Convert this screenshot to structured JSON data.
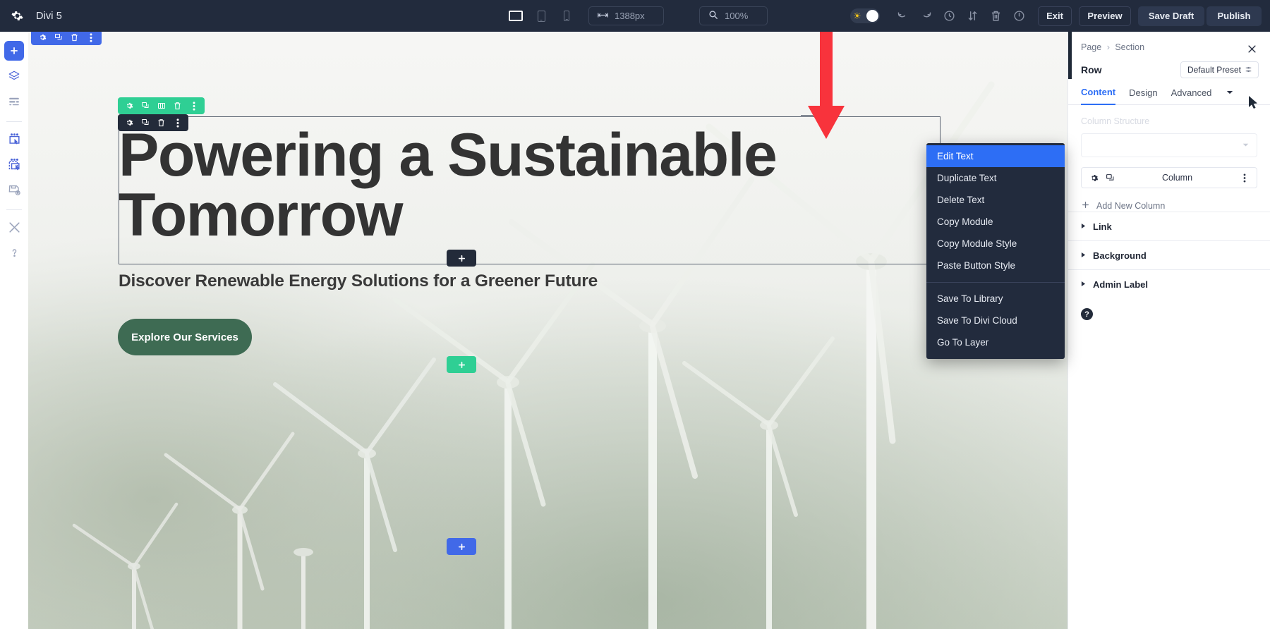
{
  "app": {
    "gear_icon": "gear-icon",
    "title": "Divi 5"
  },
  "topbar": {
    "devices": [
      {
        "name": "desktop-view-button",
        "icon": "desktop-icon",
        "active": true
      },
      {
        "name": "tablet-view-button",
        "icon": "tablet-icon",
        "active": false
      },
      {
        "name": "phone-view-button",
        "icon": "phone-icon",
        "active": false
      }
    ],
    "width_field": {
      "icon": "arrows-horizontal-icon",
      "value": "1388px"
    },
    "zoom_field": {
      "icon": "magnifier-icon",
      "value": "100%"
    },
    "theme_toggle": {
      "icon": "sun-icon",
      "state": "light"
    },
    "icons": [
      {
        "name": "undo-button",
        "icon": "undo-icon"
      },
      {
        "name": "redo-button",
        "icon": "redo-icon"
      },
      {
        "name": "history-button",
        "icon": "clock-icon"
      },
      {
        "name": "responsive-sort-button",
        "icon": "arrows-updown-icon"
      },
      {
        "name": "trash-button",
        "icon": "trash-icon"
      },
      {
        "name": "power-button",
        "icon": "power-icon"
      }
    ],
    "exit_label": "Exit",
    "preview_label": "Preview",
    "save_draft_label": "Save Draft",
    "publish_label": "Publish"
  },
  "rail": {
    "items": [
      {
        "name": "add-element-button",
        "icon": "plus-icon",
        "active": true
      },
      {
        "name": "layers-button",
        "icon": "layers-icon",
        "active": false
      },
      {
        "name": "wireframe-button",
        "icon": "wireframe-icon",
        "active": false
      },
      {
        "name": "select-module-button",
        "icon": "select-module-icon",
        "active": false
      },
      {
        "name": "multiselect-button",
        "icon": "multiselect-icon",
        "active": false
      },
      {
        "name": "save-layout-button",
        "icon": "save-layout-icon",
        "active": false
      },
      {
        "name": "tools-button",
        "icon": "wrench-icon",
        "active": false
      },
      {
        "name": "help-button",
        "icon": "question-mark-icon",
        "active": false
      }
    ]
  },
  "canvas": {
    "corner_toolbar": [
      "gear-icon",
      "duplicate-icon",
      "trash-icon",
      "dots-vertical-icon"
    ],
    "row_toolbar": [
      "gear-icon",
      "duplicate-icon",
      "columns-icon",
      "trash-icon",
      "dots-vertical-icon"
    ],
    "module_toolbar": [
      "gear-icon",
      "duplicate-icon",
      "trash-icon",
      "dots-vertical-icon"
    ],
    "headline": "Powering a Sustainable Tomorrow",
    "subheadline": "Discover Renewable Energy Solutions for a Greener Future",
    "cta_label": "Explore Our Services",
    "add_chips": [
      {
        "name": "add-module-chip-dark",
        "label": "+"
      },
      {
        "name": "add-row-chip-green",
        "label": "+"
      },
      {
        "name": "add-section-chip-blue",
        "label": "+"
      }
    ]
  },
  "context_menu": {
    "items": [
      {
        "label": "Edit Text",
        "active": true
      },
      {
        "label": "Duplicate Text",
        "active": false
      },
      {
        "label": "Delete Text",
        "active": false
      },
      {
        "label": "Copy Module",
        "active": false
      },
      {
        "label": "Copy Module Style",
        "active": false
      },
      {
        "label": "Paste Button Style",
        "active": false
      }
    ],
    "items2": [
      {
        "label": "Save To Library"
      },
      {
        "label": "Save To Divi Cloud"
      },
      {
        "label": "Go To Layer"
      }
    ]
  },
  "panel": {
    "breadcrumb_parent": "Page",
    "breadcrumb_sep": "›",
    "breadcrumb_current": "Section",
    "close_icon": "close-icon",
    "title": "Row",
    "preset_label": "Default Preset",
    "preset_icon": "preset-icon",
    "tabs": [
      {
        "label": "Content",
        "active": true
      },
      {
        "label": "Design",
        "active": false
      },
      {
        "label": "Advanced",
        "active": false
      }
    ],
    "tab_caret_icon": "chevron-down-icon",
    "column_structure_label": "Column Structure",
    "column_structure_value": "",
    "column_row": {
      "gear_icon": "gear-icon",
      "duplicate_icon": "duplicate-icon",
      "label": "Column",
      "more_icon": "dots-vertical-icon"
    },
    "add_new_column_label": "Add New Column",
    "accordions": [
      {
        "label": "Link"
      },
      {
        "label": "Background"
      },
      {
        "label": "Admin Label"
      }
    ],
    "help_label": "?"
  },
  "annotation": {
    "arrow_color": "#f8333c",
    "arrow_icon": "down-arrow-annotation"
  },
  "cursor": {
    "icon": "mouse-pointer-icon"
  },
  "colors": {
    "topbar_bg": "#222b3d",
    "accent_blue": "#4169e8",
    "menu_highlight": "#2d6ef5",
    "green_toolbar": "#2fcf94",
    "cta_green": "#3e6b53",
    "annotation_red": "#f8333c"
  }
}
